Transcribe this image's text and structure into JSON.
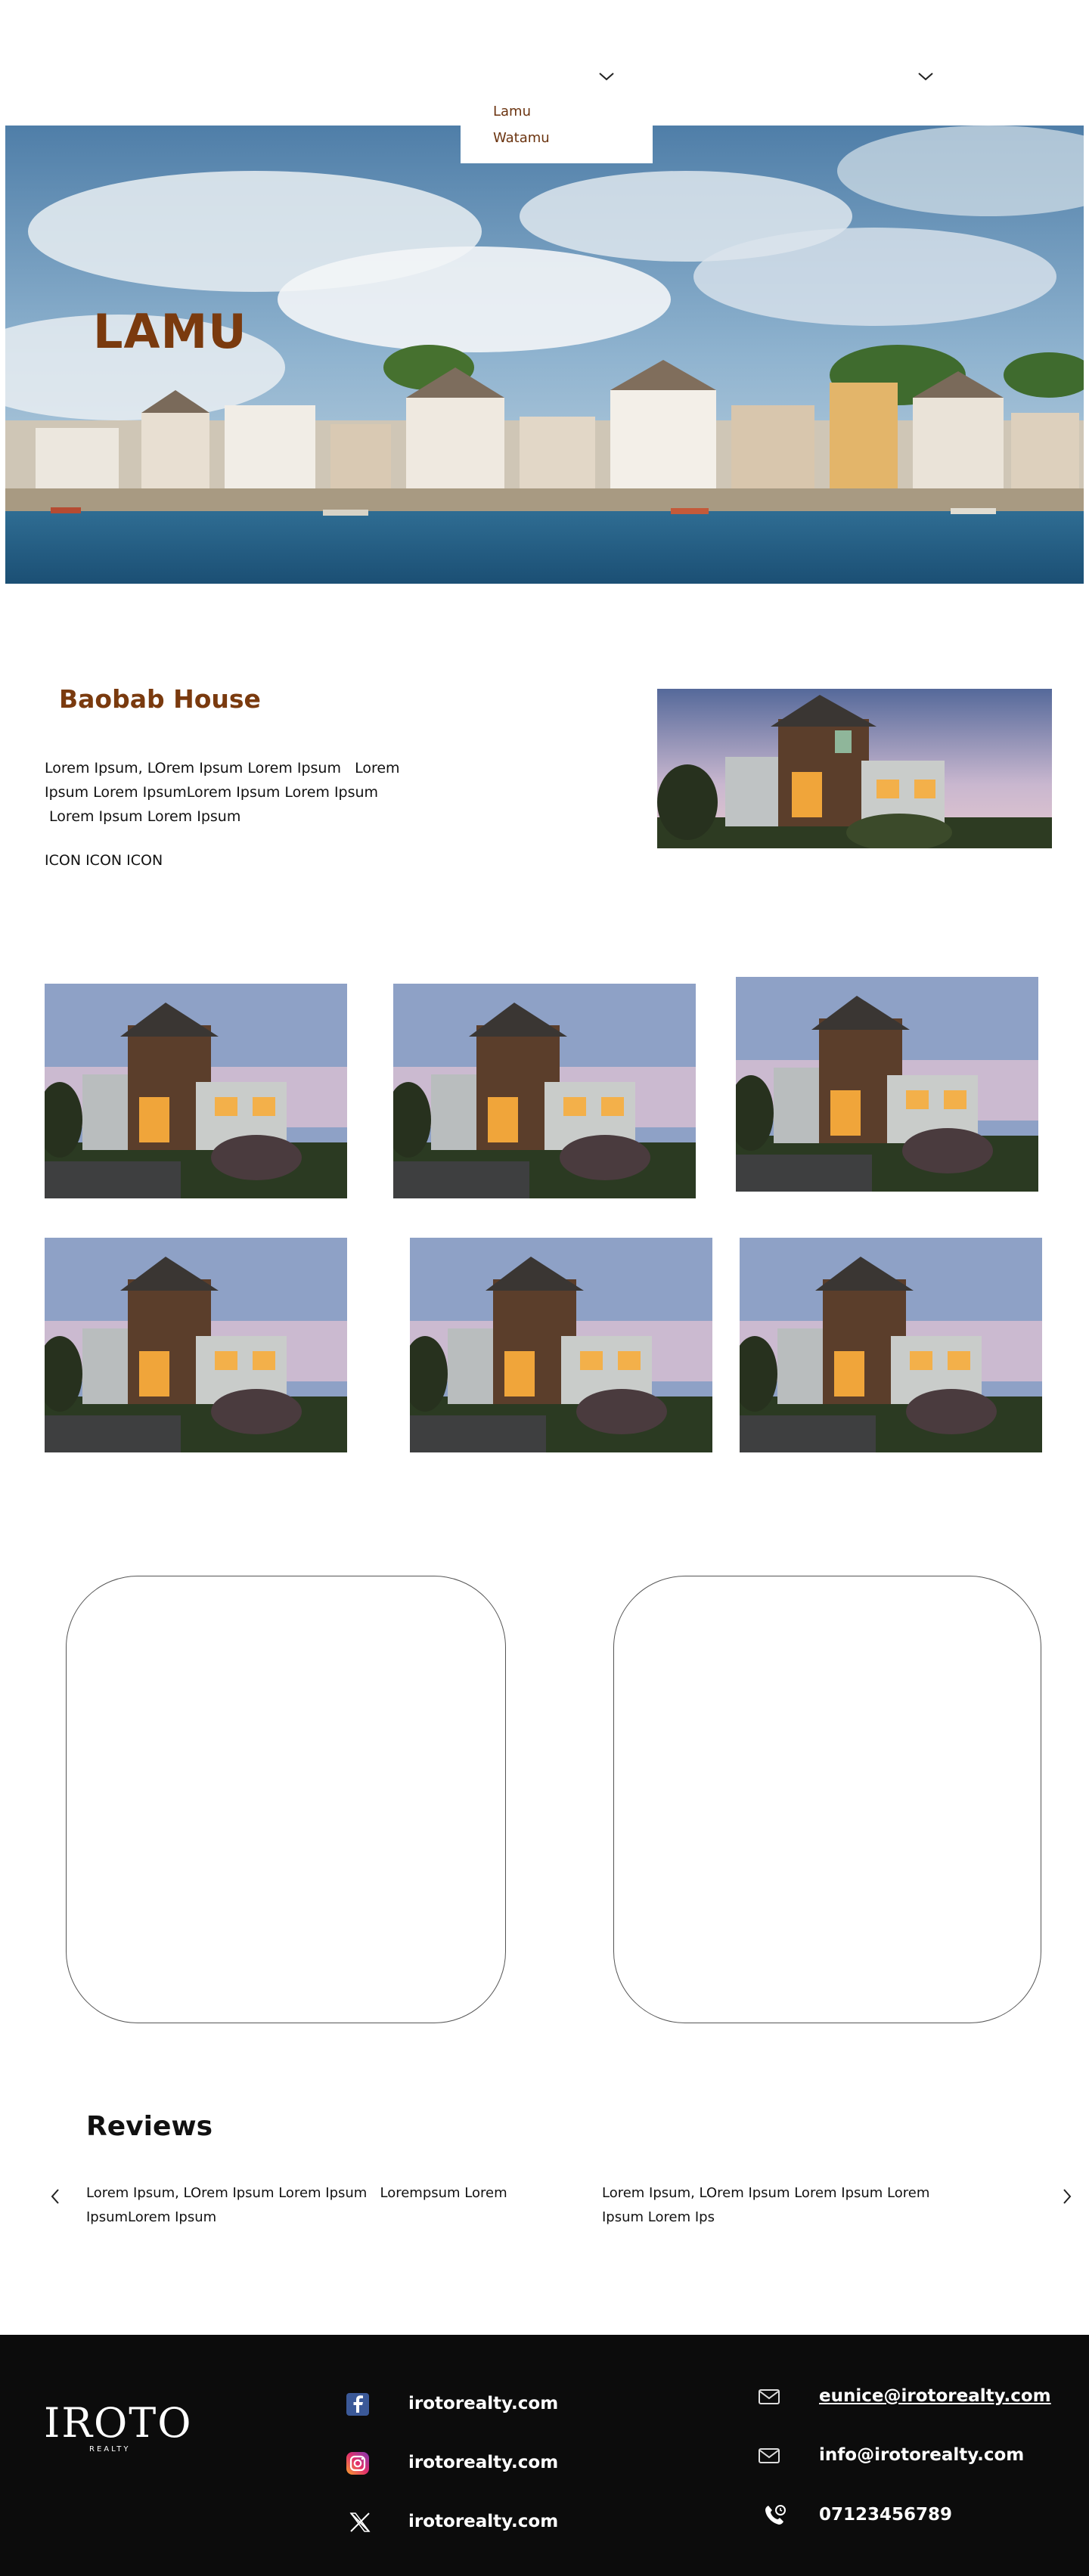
{
  "nav": {
    "dropdown_items": [
      "Lamu",
      "Watamu"
    ]
  },
  "hero": {
    "title": "LAMU"
  },
  "property": {
    "title": "Baobab House",
    "description": "Lorem Ipsum, LOrem Ipsum Lorem Ipsum   Lorem\nIpsum Lorem IpsumLorem Ipsum Lorem Ipsum\n Lorem Ipsum Lorem Ipsum",
    "icons_placeholder": "ICON ICON ICON"
  },
  "reviews": {
    "title": "Reviews",
    "items": [
      {
        "text": "Lorem Ipsum, LOrem Ipsum Lorem Ipsum   Lorempsum Lorem\nIpsumLorem Ipsum"
      },
      {
        "text": "Lorem Ipsum, LOrem Ipsum Lorem Ipsum Lorem\nIpsum Lorem Ips"
      }
    ]
  },
  "footer": {
    "logo_text": "IROTO",
    "logo_subtext": "REALTY",
    "social": [
      {
        "icon": "facebook-icon",
        "label": "irotorealty.com"
      },
      {
        "icon": "instagram-icon",
        "label": "irotorealty.com"
      },
      {
        "icon": "x-twitter-icon",
        "label": "irotorealty.com"
      }
    ],
    "contacts": [
      {
        "icon": "mail-icon",
        "label": "eunice@irotorealty.com"
      },
      {
        "icon": "mail-icon",
        "label": "info@irotorealty.com"
      },
      {
        "icon": "phone-icon",
        "label": "07123456789"
      }
    ]
  },
  "colors": {
    "brand_brown": "#7a3a0e",
    "footer_bg": "#0c0c0c",
    "text": "#111111"
  }
}
